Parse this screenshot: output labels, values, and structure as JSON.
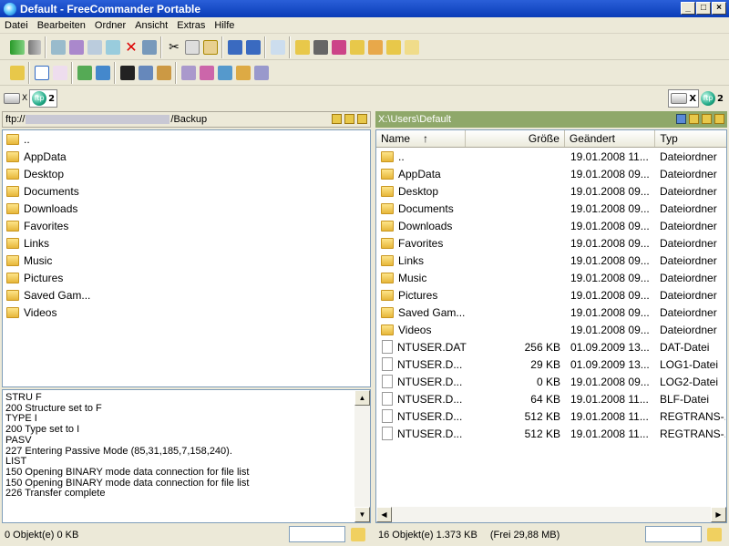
{
  "window": {
    "title": "Default - FreeCommander Portable",
    "buttons": [
      "_",
      "×",
      "×"
    ]
  },
  "menu": [
    "Datei",
    "Bearbeiten",
    "Ordner",
    "Ansicht",
    "Extras",
    "Hilfe"
  ],
  "drives": {
    "left": {
      "disk_label": "X",
      "net_label": "2"
    },
    "right": {
      "disk_label": "X",
      "net_label": "2"
    }
  },
  "left_panel": {
    "path_prefix": "ftp://",
    "path_suffix": "/Backup",
    "items": [
      "..",
      "AppData",
      "Desktop",
      "Documents",
      "Downloads",
      "Favorites",
      "Links",
      "Music",
      "Pictures",
      "Saved Gam...",
      "Videos"
    ]
  },
  "log": [
    "STRU F",
    "200 Structure set to F",
    "TYPE I",
    "200 Type set to I",
    "PASV",
    "227 Entering Passive Mode (85,31,185,7,158,240).",
    "LIST",
    "150 Opening BINARY mode data connection for file list",
    "150 Opening BINARY mode data connection for file list",
    "226 Transfer complete"
  ],
  "right_panel": {
    "path": "X:\\Users\\Default",
    "columns": {
      "name": "Name",
      "sort": "↑",
      "size": "Größe",
      "modified": "Geändert",
      "type": "Typ"
    },
    "rows": [
      {
        "name": "..",
        "size": "",
        "date": "19.01.2008 11...",
        "type": "Dateiordner",
        "kind": "folder"
      },
      {
        "name": "AppData",
        "size": "",
        "date": "19.01.2008 09...",
        "type": "Dateiordner",
        "kind": "folder"
      },
      {
        "name": "Desktop",
        "size": "",
        "date": "19.01.2008 09...",
        "type": "Dateiordner",
        "kind": "folder"
      },
      {
        "name": "Documents",
        "size": "",
        "date": "19.01.2008 09...",
        "type": "Dateiordner",
        "kind": "folder"
      },
      {
        "name": "Downloads",
        "size": "",
        "date": "19.01.2008 09...",
        "type": "Dateiordner",
        "kind": "folder"
      },
      {
        "name": "Favorites",
        "size": "",
        "date": "19.01.2008 09...",
        "type": "Dateiordner",
        "kind": "folder"
      },
      {
        "name": "Links",
        "size": "",
        "date": "19.01.2008 09...",
        "type": "Dateiordner",
        "kind": "folder"
      },
      {
        "name": "Music",
        "size": "",
        "date": "19.01.2008 09...",
        "type": "Dateiordner",
        "kind": "folder"
      },
      {
        "name": "Pictures",
        "size": "",
        "date": "19.01.2008 09...",
        "type": "Dateiordner",
        "kind": "folder"
      },
      {
        "name": "Saved Gam...",
        "size": "",
        "date": "19.01.2008 09...",
        "type": "Dateiordner",
        "kind": "folder"
      },
      {
        "name": "Videos",
        "size": "",
        "date": "19.01.2008 09...",
        "type": "Dateiordner",
        "kind": "folder"
      },
      {
        "name": "NTUSER.DAT",
        "size": "256 KB",
        "date": "01.09.2009 13...",
        "type": "DAT-Datei",
        "kind": "file"
      },
      {
        "name": "NTUSER.D...",
        "size": "29 KB",
        "date": "01.09.2009 13...",
        "type": "LOG1-Datei",
        "kind": "file"
      },
      {
        "name": "NTUSER.D...",
        "size": "0 KB",
        "date": "19.01.2008 09...",
        "type": "LOG2-Datei",
        "kind": "file"
      },
      {
        "name": "NTUSER.D...",
        "size": "64 KB",
        "date": "19.01.2008 11...",
        "type": "BLF-Datei",
        "kind": "file"
      },
      {
        "name": "NTUSER.D...",
        "size": "512 KB",
        "date": "19.01.2008 11...",
        "type": "REGTRANS-...",
        "kind": "file"
      },
      {
        "name": "NTUSER.D...",
        "size": "512 KB",
        "date": "19.01.2008 11...",
        "type": "REGTRANS-...",
        "kind": "file"
      }
    ]
  },
  "status": {
    "left": "0 Objekt(e)   0 KB",
    "right_count": "16 Objekt(e)   1.373 KB",
    "right_free": "(Frei 29,88 MB)"
  },
  "colors": {
    "title": "#0a3cb8",
    "active_path": "#8fa86a",
    "folder": "#e7b73a"
  }
}
